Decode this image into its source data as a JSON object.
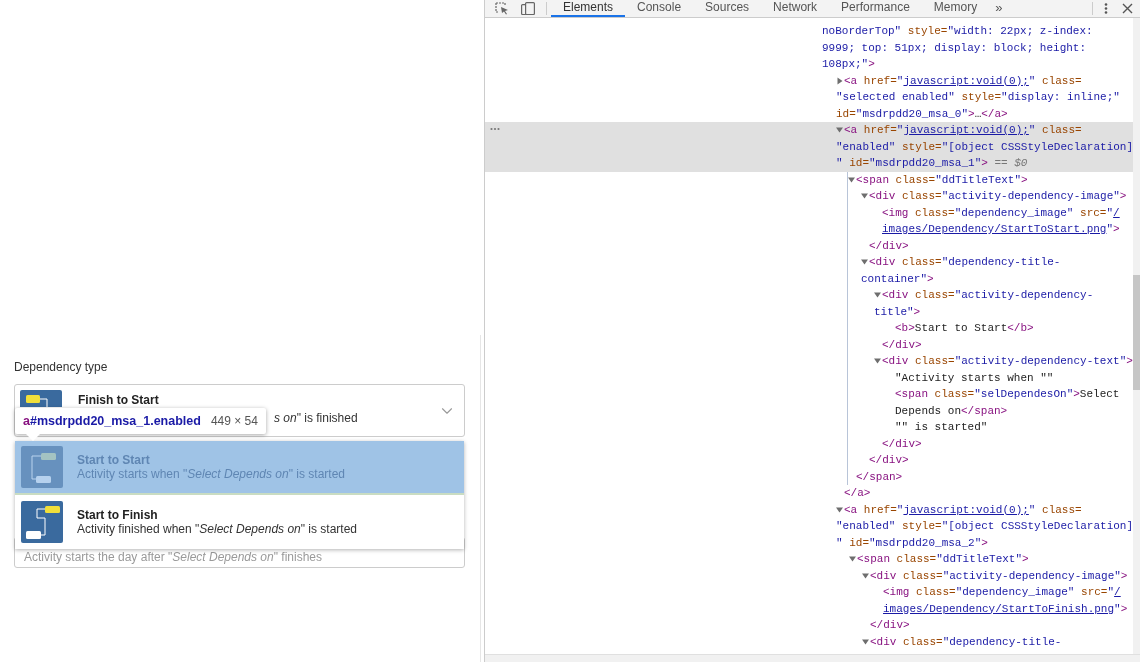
{
  "form": {
    "field_label": "Dependency type",
    "select": {
      "kind": "finish-start",
      "title": "Finish to Start",
      "subtitle": "*s on*\" is finished"
    },
    "options": [
      {
        "kind": "start-start",
        "title": "Start to Start",
        "subtitle": "Activity starts when \"*Select Depends on*\" is started",
        "selected": true
      },
      {
        "kind": "start-finish",
        "title": "Start to Finish",
        "subtitle": "Activity finished when \"*Select Depends on*\" is started",
        "selected": false
      }
    ],
    "next_field": {
      "text": "Activity starts the day after \"*Select Depends on*\" finishes"
    }
  },
  "tooltip": {
    "tag": "a",
    "selector": "#msdrpdd20_msa_1.enabled",
    "size": "449 × 54"
  },
  "devtools": {
    "tabs": [
      {
        "label": "Elements",
        "selected": true
      },
      {
        "label": "Console",
        "selected": false
      },
      {
        "label": "Sources",
        "selected": false
      },
      {
        "label": "Network",
        "selected": false
      },
      {
        "label": "Performance",
        "selected": false
      },
      {
        "label": "Memory",
        "selected": false
      }
    ],
    "more_tabs": "»",
    "dom": {
      "head_lines": [
        [
          {
            "kind": "value",
            "text": "noBorderTop\""
          },
          {
            "kind": "attr",
            "text": " style="
          },
          {
            "kind": "value",
            "text": "\"width: 22px; z-index:"
          }
        ],
        [
          {
            "kind": "value",
            "text": "9999; top: 51px; display: block; height:"
          }
        ],
        [
          {
            "kind": "value",
            "text": "108px;\""
          },
          {
            "kind": "tag",
            "text": ">"
          }
        ]
      ],
      "nodes": [
        {
          "selected": false,
          "expanded": false,
          "lines": [
            [
              {
                "kind": "tag",
                "text": "<a "
              },
              {
                "kind": "attr",
                "text": "href="
              },
              {
                "kind": "value",
                "text": "\""
              },
              {
                "kind": "link",
                "text": "javascript:void(0);"
              },
              {
                "kind": "value",
                "text": "\""
              },
              {
                "kind": "attr",
                "text": " class="
              }
            ],
            [
              {
                "kind": "value",
                "text": "\"selected enabled\""
              },
              {
                "kind": "attr",
                "text": " style="
              },
              {
                "kind": "value",
                "text": "\"display: inline;\""
              }
            ],
            [
              {
                "kind": "attr",
                "text": "id="
              },
              {
                "kind": "value",
                "text": "\"msdrpdd20_msa_0\""
              },
              {
                "kind": "tag",
                "text": ">"
              },
              {
                "kind": "text",
                "text": "…"
              },
              {
                "kind": "tag",
                "text": "</a>"
              }
            ]
          ]
        },
        {
          "selected": true,
          "expanded": true,
          "lines": [
            [
              {
                "kind": "tag",
                "text": "<a "
              },
              {
                "kind": "attr",
                "text": "href="
              },
              {
                "kind": "value",
                "text": "\""
              },
              {
                "kind": "link",
                "text": "javascript:void(0);"
              },
              {
                "kind": "value",
                "text": "\""
              },
              {
                "kind": "attr",
                "text": " class="
              }
            ],
            [
              {
                "kind": "value",
                "text": "\"enabled\""
              },
              {
                "kind": "attr",
                "text": " style="
              },
              {
                "kind": "value",
                "text": "\"[object CSSStyleDeclaration]"
              }
            ],
            [
              {
                "kind": "value",
                "text": "\""
              },
              {
                "kind": "attr",
                "text": " id="
              },
              {
                "kind": "value",
                "text": "\"msdrpdd20_msa_1\""
              },
              {
                "kind": "tag",
                "text": ">"
              },
              {
                "kind": "note",
                "text": " == $0"
              }
            ]
          ],
          "close": [
            {
              "kind": "tag",
              "text": "</a>"
            }
          ],
          "children": [
            {
              "selected": false,
              "expanded": true,
              "lines": [
                [
                  {
                    "kind": "tag",
                    "text": "<span "
                  },
                  {
                    "kind": "attr",
                    "text": "class="
                  },
                  {
                    "kind": "value",
                    "text": "\"ddTitleText\""
                  },
                  {
                    "kind": "tag",
                    "text": ">"
                  }
                ]
              ],
              "close": [
                {
                  "kind": "tag",
                  "text": "</span>"
                }
              ],
              "children": [
                {
                  "selected": false,
                  "expanded": true,
                  "lines": [
                    [
                      {
                        "kind": "tag",
                        "text": "<div "
                      },
                      {
                        "kind": "attr",
                        "text": "class="
                      },
                      {
                        "kind": "value",
                        "text": "\"activity-dependency-image\""
                      },
                      {
                        "kind": "tag",
                        "text": ">"
                      }
                    ]
                  ],
                  "close": [
                    {
                      "kind": "tag",
                      "text": "</div>"
                    }
                  ],
                  "children": [
                    {
                      "selected": false,
                      "lines": [
                        [
                          {
                            "kind": "tag",
                            "text": "<img "
                          },
                          {
                            "kind": "attr",
                            "text": "class="
                          },
                          {
                            "kind": "value",
                            "text": "\"dependency_image\""
                          },
                          {
                            "kind": "attr",
                            "text": " src="
                          },
                          {
                            "kind": "value",
                            "text": "\""
                          },
                          {
                            "kind": "link",
                            "text": "/"
                          }
                        ],
                        [
                          {
                            "kind": "link",
                            "text": "images/Dependency/StartToStart.png"
                          },
                          {
                            "kind": "value",
                            "text": "\""
                          },
                          {
                            "kind": "tag",
                            "text": ">"
                          }
                        ]
                      ]
                    }
                  ]
                },
                {
                  "selected": false,
                  "expanded": true,
                  "lines": [
                    [
                      {
                        "kind": "tag",
                        "text": "<div "
                      },
                      {
                        "kind": "attr",
                        "text": "class="
                      },
                      {
                        "kind": "value",
                        "text": "\"dependency-title-"
                      }
                    ],
                    [
                      {
                        "kind": "value",
                        "text": "container\""
                      },
                      {
                        "kind": "tag",
                        "text": ">"
                      }
                    ]
                  ],
                  "close": [
                    {
                      "kind": "tag",
                      "text": "</div>"
                    }
                  ],
                  "children": [
                    {
                      "selected": false,
                      "expanded": true,
                      "lines": [
                        [
                          {
                            "kind": "tag",
                            "text": "<div "
                          },
                          {
                            "kind": "attr",
                            "text": "class="
                          },
                          {
                            "kind": "value",
                            "text": "\"activity-dependency-"
                          }
                        ],
                        [
                          {
                            "kind": "value",
                            "text": "title\""
                          },
                          {
                            "kind": "tag",
                            "text": ">"
                          }
                        ]
                      ],
                      "close": [
                        {
                          "kind": "tag",
                          "text": "</div>"
                        }
                      ],
                      "children": [
                        {
                          "selected": false,
                          "lines": [
                            [
                              {
                                "kind": "tag",
                                "text": "<b>"
                              },
                              {
                                "kind": "text",
                                "text": "Start to Start"
                              },
                              {
                                "kind": "tag",
                                "text": "</b>"
                              }
                            ]
                          ]
                        }
                      ]
                    },
                    {
                      "selected": false,
                      "expanded": true,
                      "lines": [
                        [
                          {
                            "kind": "tag",
                            "text": "<div "
                          },
                          {
                            "kind": "attr",
                            "text": "class="
                          },
                          {
                            "kind": "value",
                            "text": "\"activity-dependency-text\""
                          },
                          {
                            "kind": "tag",
                            "text": ">"
                          }
                        ]
                      ],
                      "close": [
                        {
                          "kind": "tag",
                          "text": "</div>"
                        }
                      ],
                      "children": [
                        {
                          "selected": false,
                          "lines": [
                            [
                              {
                                "kind": "text",
                                "text": "\"Activity starts when \"\""
                              }
                            ]
                          ]
                        },
                        {
                          "selected": false,
                          "lines": [
                            [
                              {
                                "kind": "tag",
                                "text": "<span "
                              },
                              {
                                "kind": "attr",
                                "text": "class="
                              },
                              {
                                "kind": "value",
                                "text": "\"selDependesOn\""
                              },
                              {
                                "kind": "tag",
                                "text": ">"
                              },
                              {
                                "kind": "text",
                                "text": "Select"
                              }
                            ],
                            [
                              {
                                "kind": "text",
                                "text": "Depends on"
                              },
                              {
                                "kind": "tag",
                                "text": "</span>"
                              }
                            ]
                          ]
                        },
                        {
                          "selected": false,
                          "lines": [
                            [
                              {
                                "kind": "text",
                                "text": "\"\" is started\""
                              }
                            ]
                          ]
                        }
                      ]
                    }
                  ]
                }
              ]
            }
          ]
        },
        {
          "selected": false,
          "expanded": true,
          "lines": [
            [
              {
                "kind": "tag",
                "text": "<a "
              },
              {
                "kind": "attr",
                "text": "href="
              },
              {
                "kind": "value",
                "text": "\""
              },
              {
                "kind": "link",
                "text": "javascript:void(0);"
              },
              {
                "kind": "value",
                "text": "\""
              },
              {
                "kind": "attr",
                "text": " class="
              }
            ],
            [
              {
                "kind": "value",
                "text": "\"enabled\""
              },
              {
                "kind": "attr",
                "text": " style="
              },
              {
                "kind": "value",
                "text": "\"[object CSSStyleDeclaration]"
              }
            ],
            [
              {
                "kind": "value",
                "text": "\""
              },
              {
                "kind": "attr",
                "text": " id="
              },
              {
                "kind": "value",
                "text": "\"msdrpdd20_msa_2\""
              },
              {
                "kind": "tag",
                "text": ">"
              }
            ]
          ],
          "children": [
            {
              "selected": false,
              "expanded": true,
              "lines": [
                [
                  {
                    "kind": "tag",
                    "text": "<span "
                  },
                  {
                    "kind": "attr",
                    "text": "class="
                  },
                  {
                    "kind": "value",
                    "text": "\"ddTitleText\""
                  },
                  {
                    "kind": "tag",
                    "text": ">"
                  }
                ]
              ],
              "children": [
                {
                  "selected": false,
                  "expanded": true,
                  "lines": [
                    [
                      {
                        "kind": "tag",
                        "text": "<div "
                      },
                      {
                        "kind": "attr",
                        "text": "class="
                      },
                      {
                        "kind": "value",
                        "text": "\"activity-dependency-image\""
                      },
                      {
                        "kind": "tag",
                        "text": ">"
                      }
                    ]
                  ],
                  "close": [
                    {
                      "kind": "tag",
                      "text": "</div>"
                    }
                  ],
                  "children": [
                    {
                      "selected": false,
                      "lines": [
                        [
                          {
                            "kind": "tag",
                            "text": "<img "
                          },
                          {
                            "kind": "attr",
                            "text": "class="
                          },
                          {
                            "kind": "value",
                            "text": "\"dependency_image\""
                          },
                          {
                            "kind": "attr",
                            "text": " src="
                          },
                          {
                            "kind": "value",
                            "text": "\""
                          },
                          {
                            "kind": "link",
                            "text": "/"
                          }
                        ],
                        [
                          {
                            "kind": "link",
                            "text": "images/Dependency/StartToFinish.png"
                          },
                          {
                            "kind": "value",
                            "text": "\""
                          },
                          {
                            "kind": "tag",
                            "text": ">"
                          }
                        ]
                      ]
                    }
                  ]
                },
                {
                  "selected": false,
                  "expanded": true,
                  "lines": [
                    [
                      {
                        "kind": "tag",
                        "text": "<div "
                      },
                      {
                        "kind": "attr",
                        "text": "class="
                      },
                      {
                        "kind": "value",
                        "text": "\"dependency-title-"
                      }
                    ]
                  ]
                }
              ]
            }
          ]
        }
      ]
    }
  }
}
